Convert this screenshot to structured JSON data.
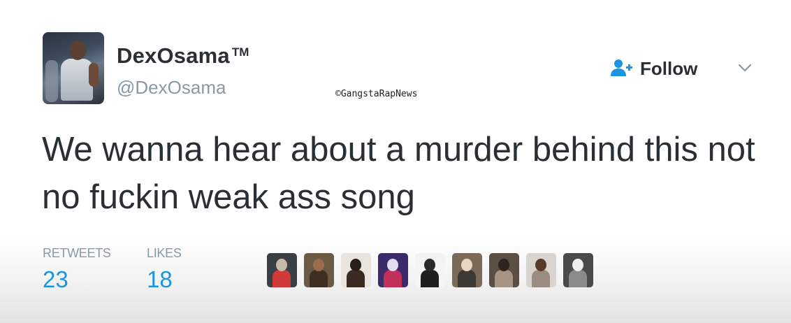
{
  "tweet": {
    "display_name": "DexOsama",
    "trademark": "TM",
    "handle": "@DexOsama",
    "follow_label": "Follow",
    "text": "We wanna hear about a murder behind this not no fuckin weak ass song",
    "watermark": "©GangstaRapNews",
    "stats": {
      "retweets_label": "RETWEETS",
      "retweets_value": "23",
      "likes_label": "LIKES",
      "likes_value": "18"
    }
  },
  "icons": {
    "follow": "add-user-icon",
    "caret": "chevron-down-icon"
  },
  "colors": {
    "accent": "#1b95e0",
    "text": "#292f33",
    "muted": "#8899a6"
  },
  "likers": [
    {
      "bg": "#3a3f46",
      "head": "#c8b9a6",
      "torso": "#d23a3a"
    },
    {
      "bg": "#6b5a44",
      "head": "#9a6b4c",
      "torso": "#3f2f22"
    },
    {
      "bg": "#e9e4de",
      "head": "#2a1e18",
      "torso": "#3a2a22"
    },
    {
      "bg": "#3b2b6a",
      "head": "#e4dcf0",
      "torso": "#c0305a"
    },
    {
      "bg": "#f4f4f4",
      "head": "#2a2a2a",
      "torso": "#1f1f1f"
    },
    {
      "bg": "#7b6a58",
      "head": "#e8d6c2",
      "torso": "#3d3a36"
    },
    {
      "bg": "#5b4e45",
      "head": "#2d2420",
      "torso": "#a89484"
    },
    {
      "bg": "#d9d4cd",
      "head": "#5a3b2a",
      "torso": "#9a8c80"
    },
    {
      "bg": "#4a4a4a",
      "head": "#eeeeee",
      "torso": "#8a8a8a"
    }
  ]
}
